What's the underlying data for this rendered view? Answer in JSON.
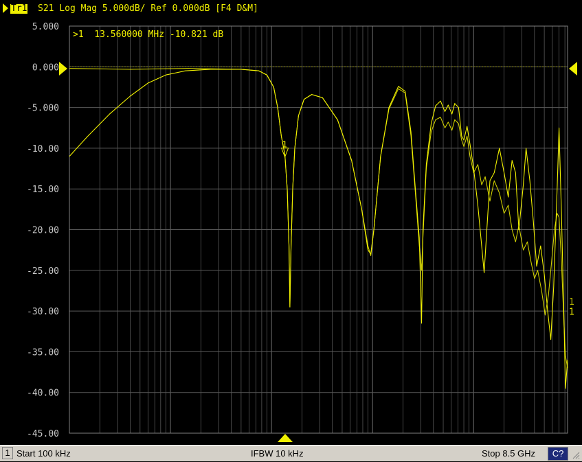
{
  "titlebar": {
    "trace_tag": "Tr1",
    "trace_title": "S21 Log Mag 5.000dB/ Ref 0.000dB [F4 D&M]"
  },
  "marker_readout": {
    "text": ">1  13.560000 MHz -10.821 dB"
  },
  "statusbar": {
    "channel": "1",
    "start": "Start 100 kHz",
    "ifbw": "IFBW 10 kHz",
    "stop": "Stop 8.5 GHz",
    "cal": "C?"
  },
  "colors": {
    "trace": "#f0f000",
    "grid": "#5a5a5a",
    "background": "#000000"
  },
  "chart_data": {
    "type": "line",
    "title": "S21 Log Mag 5.000dB/ Ref 0.000dB",
    "x_scale": "log",
    "x_unit": "Hz",
    "xlim": [
      100000,
      8500000000
    ],
    "y_unit": "dB",
    "ylim": [
      -45,
      5
    ],
    "y_ticks": [
      "5.000",
      "0.000",
      "-5.000",
      "-10.00",
      "-15.00",
      "-20.00",
      "-25.00",
      "-30.00",
      "-35.00",
      "-40.00",
      "-45.00"
    ],
    "reference_level": 0,
    "grid": true,
    "marker": {
      "label": "1",
      "x": 13560000,
      "y": -10.821
    },
    "series": [
      {
        "points": [
          [
            100000,
            -11.0
          ],
          [
            150000,
            -8.6
          ],
          [
            250000,
            -5.8
          ],
          [
            400000,
            -3.6
          ],
          [
            600000,
            -2.0
          ],
          [
            900000,
            -1.0
          ],
          [
            1400000,
            -0.5
          ],
          [
            2500000,
            -0.3
          ],
          [
            5000000,
            -0.3
          ],
          [
            7500000,
            -0.5
          ],
          [
            9000000,
            -1.0
          ],
          [
            10500000,
            -2.5
          ],
          [
            11500000,
            -5.0
          ],
          [
            12500000,
            -8.5
          ],
          [
            13560000,
            -10.8
          ],
          [
            14300000,
            -15.0
          ],
          [
            14900000,
            -22.0
          ],
          [
            15200000,
            -29.5
          ],
          [
            15600000,
            -22.0
          ],
          [
            16200000,
            -15.0
          ],
          [
            17000000,
            -10.0
          ],
          [
            18500000,
            -6.0
          ],
          [
            21000000,
            -4.0
          ],
          [
            25000000,
            -3.4
          ],
          [
            32000000,
            -3.8
          ],
          [
            45000000,
            -6.5
          ],
          [
            62000000,
            -11.5
          ],
          [
            78000000,
            -17.5
          ],
          [
            90000000,
            -22.5
          ],
          [
            96000000,
            -23.0
          ],
          [
            103000000,
            -20.0
          ],
          [
            120000000,
            -11.0
          ],
          [
            145000000,
            -5.0
          ],
          [
            180000000,
            -2.4
          ],
          [
            210000000,
            -3.0
          ],
          [
            240000000,
            -8.0
          ],
          [
            265000000,
            -15.0
          ],
          [
            290000000,
            -21.0
          ],
          [
            305000000,
            -31.5
          ],
          [
            315000000,
            -20.0
          ],
          [
            340000000,
            -12.0
          ],
          [
            380000000,
            -7.0
          ],
          [
            420000000,
            -4.8
          ],
          [
            470000000,
            -4.2
          ],
          [
            520000000,
            -5.5
          ],
          [
            560000000,
            -4.7
          ],
          [
            610000000,
            -5.8
          ],
          [
            650000000,
            -4.5
          ],
          [
            710000000,
            -5.0
          ],
          [
            760000000,
            -8.5
          ],
          [
            800000000,
            -9.0
          ],
          [
            860000000,
            -7.3
          ],
          [
            920000000,
            -9.5
          ],
          [
            1000000000,
            -12.5
          ],
          [
            1100000000,
            -17.0
          ],
          [
            1200000000,
            -22.0
          ],
          [
            1270000000,
            -25.3
          ],
          [
            1350000000,
            -20.0
          ],
          [
            1450000000,
            -14.0
          ],
          [
            1600000000,
            -13.0
          ],
          [
            1800000000,
            -10.0
          ],
          [
            2000000000,
            -13.0
          ],
          [
            2200000000,
            -16.0
          ],
          [
            2400000000,
            -11.5
          ],
          [
            2600000000,
            -13.0
          ],
          [
            2800000000,
            -20.0
          ],
          [
            3100000000,
            -14.5
          ],
          [
            3300000000,
            -10.0
          ],
          [
            3600000000,
            -14.0
          ],
          [
            3900000000,
            -19.0
          ],
          [
            4200000000,
            -24.5
          ],
          [
            4600000000,
            -22.0
          ],
          [
            5000000000,
            -25.5
          ],
          [
            5400000000,
            -30.0
          ],
          [
            5800000000,
            -33.5
          ],
          [
            6200000000,
            -27.0
          ],
          [
            6700000000,
            -15.0
          ],
          [
            7000000000,
            -7.5
          ],
          [
            7400000000,
            -18.0
          ],
          [
            7800000000,
            -30.0
          ],
          [
            8100000000,
            -39.5
          ],
          [
            8500000000,
            -36.0
          ]
        ]
      },
      {
        "points": [
          [
            100000,
            -0.2
          ],
          [
            400000,
            -0.3
          ],
          [
            1500000,
            -0.2
          ],
          [
            5000000,
            -0.3
          ],
          [
            7500000,
            -0.5
          ],
          [
            9000000,
            -1.0
          ],
          [
            10500000,
            -2.5
          ],
          [
            11500000,
            -5.0
          ],
          [
            12500000,
            -8.5
          ],
          [
            13560000,
            -10.8
          ],
          [
            14300000,
            -15.0
          ],
          [
            14900000,
            -22.0
          ],
          [
            15200000,
            -29.5
          ],
          [
            15600000,
            -22.0
          ],
          [
            16200000,
            -15.0
          ],
          [
            17000000,
            -10.0
          ],
          [
            18500000,
            -6.0
          ],
          [
            21000000,
            -4.0
          ],
          [
            25000000,
            -3.4
          ],
          [
            32000000,
            -3.8
          ],
          [
            45000000,
            -6.5
          ],
          [
            62000000,
            -11.5
          ],
          [
            78000000,
            -17.5
          ],
          [
            90000000,
            -22.0
          ],
          [
            96000000,
            -23.2
          ],
          [
            103000000,
            -20.0
          ],
          [
            120000000,
            -11.0
          ],
          [
            145000000,
            -5.2
          ],
          [
            180000000,
            -2.7
          ],
          [
            210000000,
            -3.2
          ],
          [
            240000000,
            -8.5
          ],
          [
            265000000,
            -15.5
          ],
          [
            290000000,
            -22.0
          ],
          [
            305000000,
            -25.0
          ],
          [
            315000000,
            -21.0
          ],
          [
            340000000,
            -12.5
          ],
          [
            380000000,
            -8.0
          ],
          [
            420000000,
            -6.5
          ],
          [
            470000000,
            -6.2
          ],
          [
            520000000,
            -7.5
          ],
          [
            560000000,
            -6.8
          ],
          [
            610000000,
            -7.8
          ],
          [
            650000000,
            -6.5
          ],
          [
            710000000,
            -7.0
          ],
          [
            760000000,
            -9.0
          ],
          [
            800000000,
            -9.8
          ],
          [
            860000000,
            -8.5
          ],
          [
            920000000,
            -11.0
          ],
          [
            1000000000,
            -13.0
          ],
          [
            1100000000,
            -12.0
          ],
          [
            1200000000,
            -14.5
          ],
          [
            1300000000,
            -13.5
          ],
          [
            1450000000,
            -16.5
          ],
          [
            1600000000,
            -14.0
          ],
          [
            1800000000,
            -15.5
          ],
          [
            2000000000,
            -18.0
          ],
          [
            2200000000,
            -17.0
          ],
          [
            2400000000,
            -20.0
          ],
          [
            2600000000,
            -21.5
          ],
          [
            2800000000,
            -19.5
          ],
          [
            3100000000,
            -22.5
          ],
          [
            3400000000,
            -21.5
          ],
          [
            3700000000,
            -24.0
          ],
          [
            4000000000,
            -26.0
          ],
          [
            4300000000,
            -25.0
          ],
          [
            4700000000,
            -27.5
          ],
          [
            5100000000,
            -30.5
          ],
          [
            5500000000,
            -28.0
          ],
          [
            5900000000,
            -24.0
          ],
          [
            6300000000,
            -20.0
          ],
          [
            6700000000,
            -18.0
          ],
          [
            7000000000,
            -18.5
          ],
          [
            7400000000,
            -24.0
          ],
          [
            7800000000,
            -31.0
          ],
          [
            8100000000,
            -35.5
          ],
          [
            8500000000,
            -37.0
          ]
        ]
      }
    ],
    "right_trace_labels": [
      "1",
      "1"
    ]
  }
}
